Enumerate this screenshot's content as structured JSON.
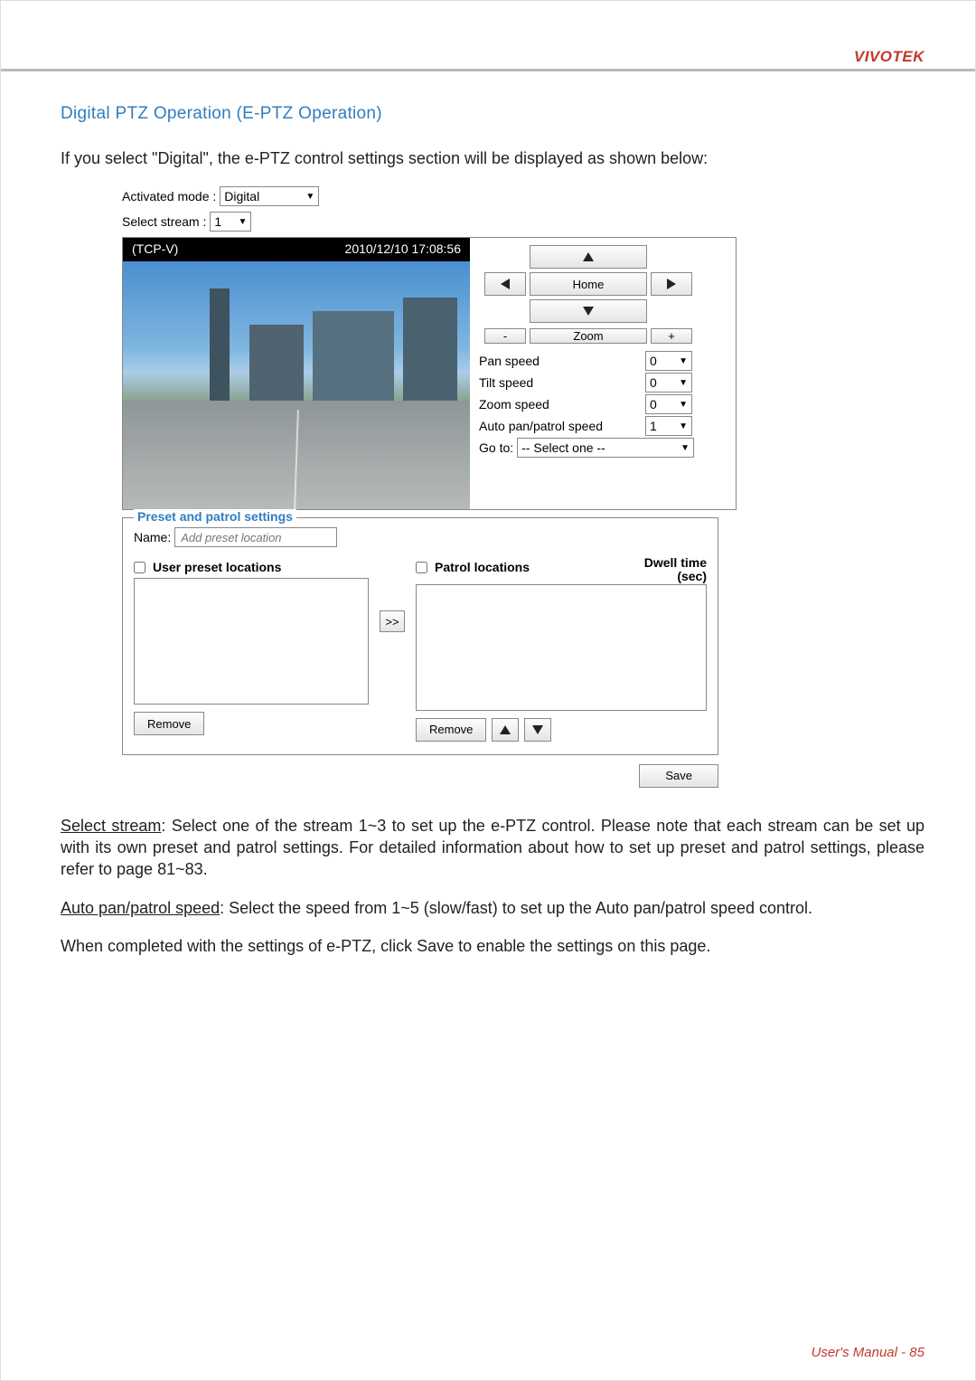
{
  "brand": "VIVOTEK",
  "section_title": "Digital PTZ Operation (E-PTZ Operation)",
  "intro": "If you select \"Digital\", the e-PTZ control settings section will be displayed as shown below:",
  "ui": {
    "activated_mode_label": "Activated mode :",
    "activated_mode_value": "Digital",
    "select_stream_label": "Select stream :",
    "select_stream_value": "1",
    "video": {
      "title": "(TCP-V)",
      "timestamp": "2010/12/10  17:08:56"
    },
    "controls": {
      "home": "Home",
      "zoom": "Zoom",
      "minus": "-",
      "plus": "+",
      "pan_speed_label": "Pan speed",
      "pan_speed_value": "0",
      "tilt_speed_label": "Tilt speed",
      "tilt_speed_value": "0",
      "zoom_speed_label": "Zoom speed",
      "zoom_speed_value": "0",
      "auto_speed_label": "Auto pan/patrol speed",
      "auto_speed_value": "1",
      "goto_label": "Go to:",
      "goto_value": "-- Select one --"
    },
    "preset": {
      "legend": "Preset and patrol settings",
      "name_label": "Name:",
      "name_placeholder": "Add preset location",
      "user_preset_header": "User preset locations",
      "patrol_header": "Patrol locations",
      "dwell_line1": "Dwell time",
      "dwell_line2": "(sec)",
      "move_right": ">>",
      "remove": "Remove",
      "save": "Save"
    }
  },
  "paragraphs": {
    "select_stream_u": "Select stream",
    "select_stream_rest": ": Select one of the stream 1~3 to set up the e-PTZ control. Please note that each stream can be set up with its own preset and patrol settings. For detailed information about how to set up preset and patrol settings, please refer to page 81~83.",
    "auto_speed_u": "Auto pan/patrol speed",
    "auto_speed_rest": ": Select the speed from 1~5 (slow/fast) to set up the Auto pan/patrol speed control.",
    "completed": "When completed with the settings of e-PTZ, click Save to enable the settings on this page."
  },
  "footer": "User's Manual - 85"
}
